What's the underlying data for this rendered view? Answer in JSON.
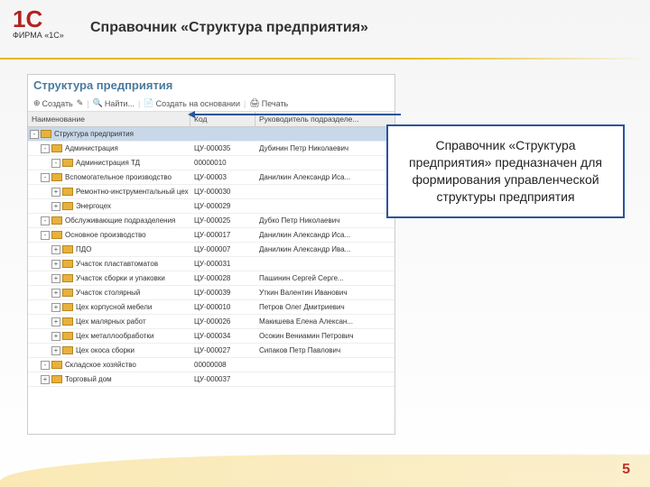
{
  "slide": {
    "title": "Справочник «Структура предприятия»",
    "page_number": "5"
  },
  "logo": {
    "brand": "1С",
    "company": "ФИРМА «1С»"
  },
  "callout": {
    "text": "Справочник «Структура предприятия» предназначен для формирования управленческой структуры предприятия"
  },
  "app": {
    "title": "Структура предприятия",
    "toolbar": {
      "create": "Создать",
      "find": "Найти...",
      "create_based": "Создать на основании",
      "print": "Печать"
    },
    "columns": {
      "name": "Наименование",
      "code": "Код",
      "manager": "Руководитель подразделе..."
    },
    "rows": [
      {
        "level": 0,
        "expand": "-",
        "name": "Структура предприятия",
        "code": "",
        "mgr": "",
        "selected": true
      },
      {
        "level": 1,
        "expand": "-",
        "name": "Администрация",
        "code": "ЦУ-000035",
        "mgr": "Дубинин Петр Николаевич"
      },
      {
        "level": 2,
        "expand": "-",
        "name": "Администрация ТД",
        "code": "00000010",
        "mgr": ""
      },
      {
        "level": 1,
        "expand": "-",
        "name": "Вспомогательное производство",
        "code": "ЦУ-00003",
        "mgr": "Данилкин Александр Иса..."
      },
      {
        "level": 2,
        "expand": "+",
        "name": "Ремонтно-инструментальный цех",
        "code": "ЦУ-000030",
        "mgr": ""
      },
      {
        "level": 2,
        "expand": "+",
        "name": "Энергоцех",
        "code": "ЦУ-000029",
        "mgr": ""
      },
      {
        "level": 1,
        "expand": "-",
        "name": "Обслуживающие подразделения",
        "code": "ЦУ-000025",
        "mgr": "Дубко Петр Николаевич"
      },
      {
        "level": 1,
        "expand": "-",
        "name": "Основное производство",
        "code": "ЦУ-000017",
        "mgr": "Данилкин Александр Иса..."
      },
      {
        "level": 2,
        "expand": "+",
        "name": "ПДО",
        "code": "ЦУ-000007",
        "mgr": "Данилкин Александр Ива..."
      },
      {
        "level": 2,
        "expand": "+",
        "name": "Участок пластавтоматов",
        "code": "ЦУ-000031",
        "mgr": ""
      },
      {
        "level": 2,
        "expand": "+",
        "name": "Участок сборки и упаковки",
        "code": "ЦУ-000028",
        "mgr": "Пашинин Сергей Серге..."
      },
      {
        "level": 2,
        "expand": "+",
        "name": "Участок столярный",
        "code": "ЦУ-000039",
        "mgr": "Уткин Валентин Иванович"
      },
      {
        "level": 2,
        "expand": "+",
        "name": "Цех корпусной мебели",
        "code": "ЦУ-000010",
        "mgr": "Петров Олег Дмитриевич"
      },
      {
        "level": 2,
        "expand": "+",
        "name": "Цех малярных работ",
        "code": "ЦУ-000026",
        "mgr": "Макишева Елена Алексан..."
      },
      {
        "level": 2,
        "expand": "+",
        "name": "Цех металлообработки",
        "code": "ЦУ-000034",
        "mgr": "Осокин Вениамин Петрович"
      },
      {
        "level": 2,
        "expand": "+",
        "name": "Цех окоса сборки",
        "code": "ЦУ-000027",
        "mgr": "Сипаков Петр Павлович"
      },
      {
        "level": 1,
        "expand": "-",
        "name": "Складское хозяйство",
        "code": "00000008",
        "mgr": ""
      },
      {
        "level": 1,
        "expand": "+",
        "name": "Торговый дом",
        "code": "ЦУ-000037",
        "mgr": ""
      }
    ]
  }
}
